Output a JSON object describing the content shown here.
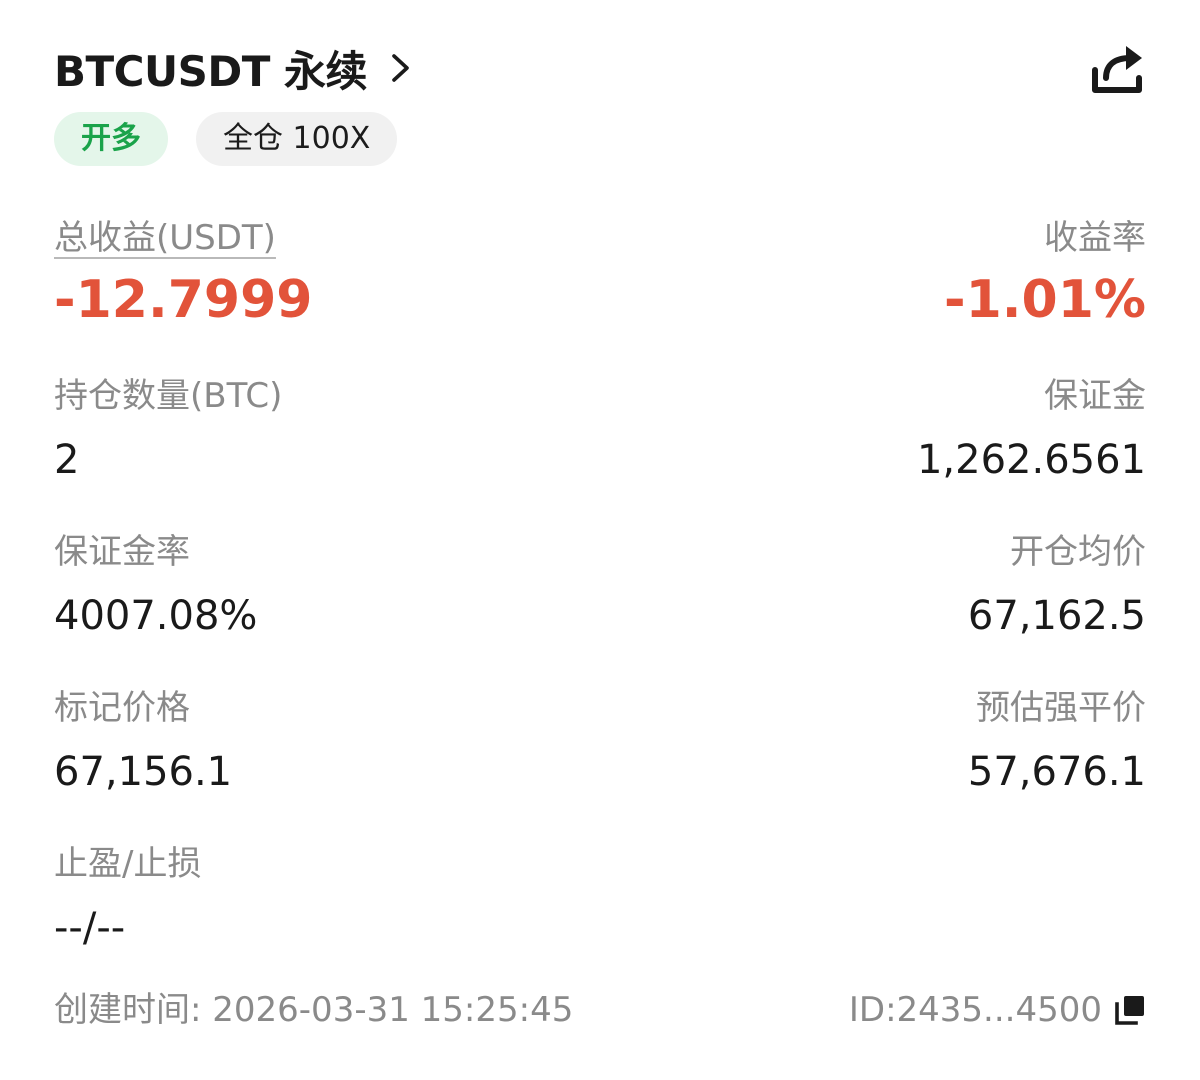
{
  "header": {
    "symbol": "BTCUSDT 永续",
    "chevron_icon": "chevron-right-icon",
    "share_icon": "share-icon"
  },
  "tags": {
    "side": "开多",
    "margin_mode": "全仓 100X"
  },
  "metrics": {
    "total_pnl_label": "总收益(USDT)",
    "total_pnl_value": "-12.7999",
    "roi_label": "收益率",
    "roi_value": "-1.01%",
    "position_size_label": "持仓数量(BTC)",
    "position_size_value": "2",
    "margin_label": "保证金",
    "margin_value": "1,262.6561",
    "margin_ratio_label": "保证金率",
    "margin_ratio_value": "4007.08%",
    "entry_price_label": "开仓均价",
    "entry_price_value": "67,162.5",
    "mark_price_label": "标记价格",
    "mark_price_value": "67,156.1",
    "liq_price_label": "预估强平价",
    "liq_price_value": "57,676.1",
    "tpsl_label": "止盈/止损",
    "tpsl_value": "--/--"
  },
  "footer": {
    "created": "创建时间: 2026-03-31 15:25:45",
    "id": "ID:2435...4500",
    "copy_icon": "copy-icon"
  },
  "colors": {
    "loss": "#e2533a",
    "long_green": "#1aa34a",
    "long_bg": "#e4f6ea",
    "tag_bg": "#f1f1f1",
    "label_gray": "#8a8a8a",
    "text": "#1a1a1a"
  }
}
